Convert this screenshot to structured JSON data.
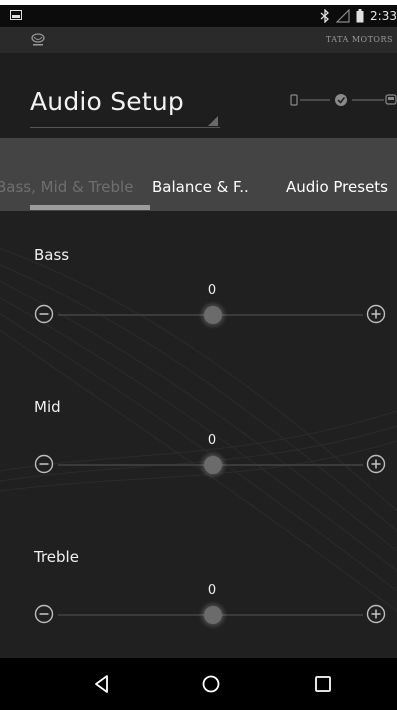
{
  "status_bar": {
    "time": "2:33",
    "icons": [
      "image-notification-icon",
      "bluetooth-icon",
      "signal-icon",
      "battery-icon"
    ]
  },
  "brand_bar": {
    "brand": "TATA MOTORS",
    "icons": [
      "tata-logo-icon"
    ]
  },
  "header": {
    "title": "Audio Setup",
    "step_icons": [
      "phone-icon",
      "check-circle-icon",
      "car-icon"
    ]
  },
  "tabs": [
    {
      "label": "Bass, Mid & Treble",
      "active": true
    },
    {
      "label": "Balance & F..",
      "active": false
    },
    {
      "label": "Audio Presets",
      "active": false
    }
  ],
  "sliders": [
    {
      "label": "Bass",
      "value": "0"
    },
    {
      "label": "Mid",
      "value": "0"
    },
    {
      "label": "Treble",
      "value": "0"
    }
  ],
  "navigation": {
    "icons": [
      "back-icon",
      "home-icon",
      "recents-icon"
    ]
  },
  "colors": {
    "background": "#1f1f1f",
    "tab_bar": "#444444",
    "indicator": "#9c9c9c",
    "text": "#ffffff"
  }
}
